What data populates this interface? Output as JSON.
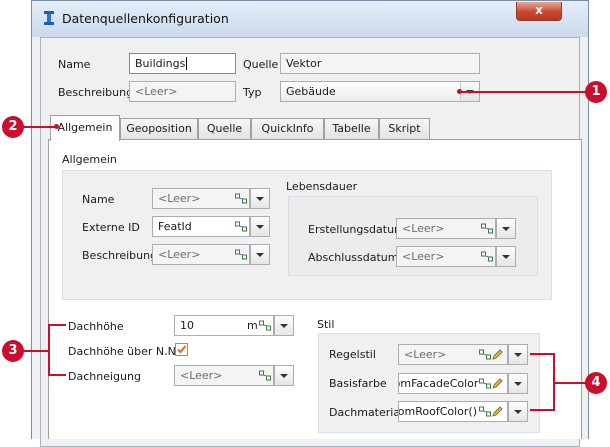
{
  "window": {
    "title": "Datenquellenkonfiguration",
    "close_label": "x"
  },
  "header": {
    "name_label": "Name",
    "name_value": "Buildings",
    "quelle_label": "Quelle",
    "quelle_value": "Vektor",
    "beschreibung_label": "Beschreibung",
    "beschreibung_placeholder": "<Leer>",
    "typ_label": "Typ",
    "typ_value": "Gebäude"
  },
  "tabs": [
    {
      "label": "Allgemein",
      "active": true
    },
    {
      "label": "Geoposition"
    },
    {
      "label": "Quelle"
    },
    {
      "label": "QuickInfo"
    },
    {
      "label": "Tabelle"
    },
    {
      "label": "Skript"
    }
  ],
  "panel": {
    "section_title": "Allgemein",
    "name_label": "Name",
    "name_placeholder": "<Leer>",
    "externe_id_label": "Externe ID",
    "externe_id_value": "FeatId",
    "beschreibung_label": "Beschreibung",
    "beschreibung_placeholder": "<Leer>",
    "lebensdauer_title": "Lebensdauer",
    "erstellungsdatum_label": "Erstellungsdatum",
    "erstellungsdatum_placeholder": "<Leer>",
    "abschlussdatum_label": "Abschlussdatum",
    "abschlussdatum_placeholder": "<Leer>",
    "dachhoehe_label": "Dachhöhe",
    "dachhoehe_value": "10",
    "dachhoehe_unit": "m",
    "dachhoehe_nn_label": "Dachhöhe über N.N.",
    "dachhoehe_nn_checked": true,
    "dachneigung_label": "Dachneigung",
    "dachneigung_placeholder": "<Leer>",
    "stil_title": "Stil",
    "regelstil_label": "Regelstil",
    "regelstil_placeholder": "<Leer>",
    "basisfarbe_label": "Basisfarbe",
    "basisfarbe_value": "domFacadeColor()",
    "dachmaterial_label": "Dachmaterial",
    "dachmaterial_value": "domRoofColor()"
  },
  "callouts": [
    "1",
    "2",
    "3",
    "4"
  ],
  "colors": {
    "callout": "#c8102e",
    "title_bar": "#cad9ec",
    "close_button": "#c7482f"
  },
  "icons": [
    "app-icon",
    "close-icon",
    "link-icon",
    "pencil-icon",
    "dropdown-arrow-icon",
    "checkmark-icon"
  ]
}
